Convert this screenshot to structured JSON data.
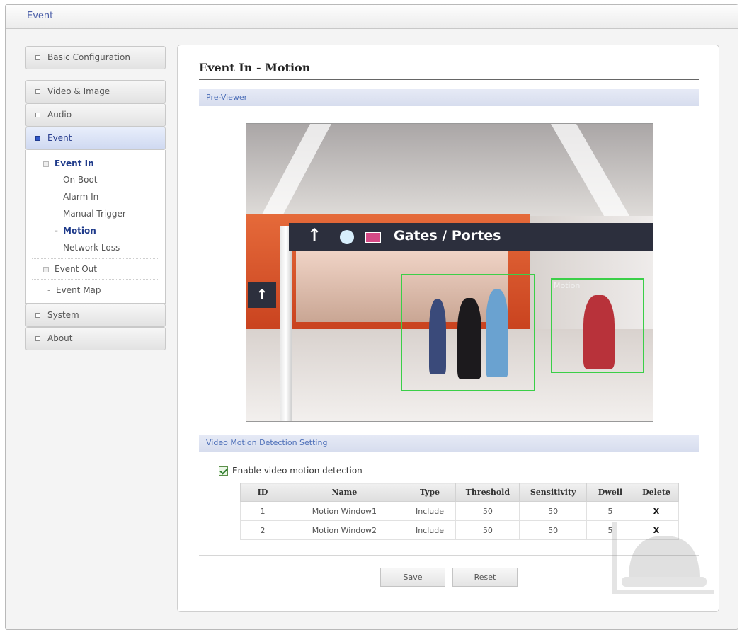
{
  "header": {
    "title": "Event"
  },
  "sidebar": {
    "top_items": [
      {
        "label": "Basic Configuration"
      },
      {
        "label": "Video & Image"
      },
      {
        "label": "Audio"
      },
      {
        "label": "Event"
      }
    ],
    "event_in": {
      "label": "Event In",
      "items": [
        "On Boot",
        "Alarm In",
        "Manual Trigger",
        "Motion",
        "Network Loss"
      ]
    },
    "event_out": {
      "label": "Event Out"
    },
    "event_map": {
      "label": "Event Map"
    },
    "bottom_items": [
      {
        "label": "System"
      },
      {
        "label": "About"
      }
    ]
  },
  "main": {
    "title": "Event In - Motion",
    "pre_viewer_label": "Pre-Viewer",
    "camera": {
      "sign_text": "Gates / Portes",
      "motion_label": "Motion"
    },
    "vmd_label": "Video Motion Detection Setting",
    "enable_label": "Enable video motion detection",
    "enable_checked": true,
    "table": {
      "columns": [
        "ID",
        "Name",
        "Type",
        "Threshold",
        "Sensitivity",
        "Dwell",
        "Delete"
      ],
      "rows": [
        {
          "id": "1",
          "name": "Motion Window1",
          "type": "Include",
          "threshold": "50",
          "sensitivity": "50",
          "dwell": "5",
          "delete": "X"
        },
        {
          "id": "2",
          "name": "Motion Window2",
          "type": "Include",
          "threshold": "50",
          "sensitivity": "50",
          "dwell": "5",
          "delete": "X"
        }
      ]
    },
    "buttons": {
      "save": "Save",
      "reset": "Reset"
    }
  },
  "colors": {
    "accent": "#2f56c8",
    "motion_box": "#3bcf48",
    "section_bar": "#d7ddee"
  }
}
